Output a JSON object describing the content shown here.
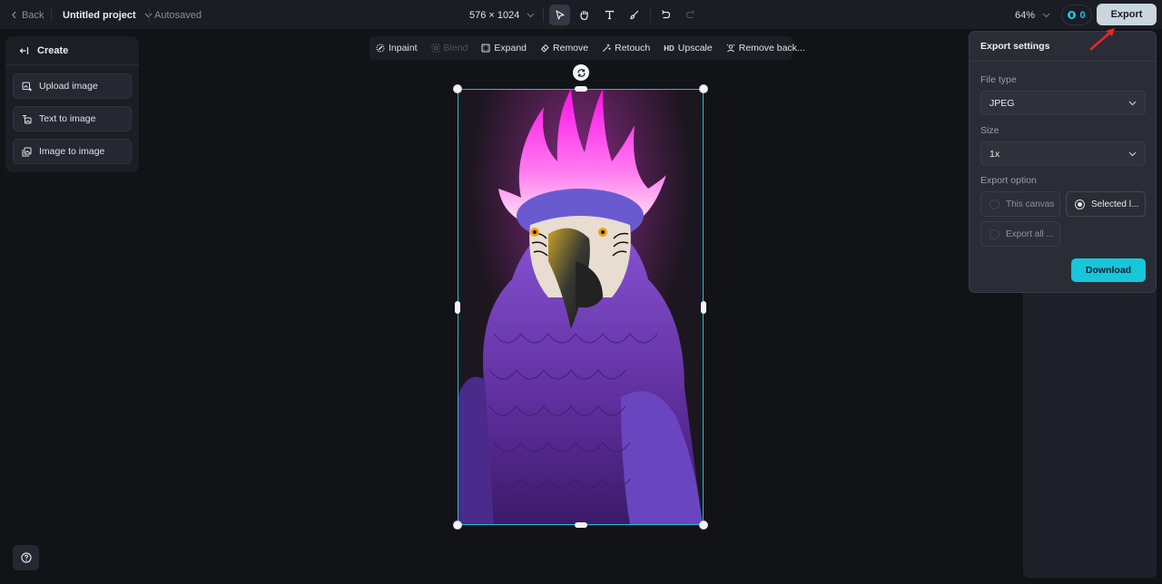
{
  "topbar": {
    "back_label": "Back",
    "project_name": "Untitled project",
    "save_status": "Autosaved",
    "canvas_dimensions": "576 × 1024",
    "tools": [
      "select",
      "hand",
      "text",
      "brush",
      "undo",
      "redo"
    ],
    "active_tool": "select",
    "zoom_level": "64%",
    "credits": "0",
    "export_label": "Export"
  },
  "create_panel": {
    "title": "Create",
    "items": [
      {
        "label": "Upload image",
        "icon": "upload-image-icon"
      },
      {
        "label": "Text to image",
        "icon": "text-to-image-icon"
      },
      {
        "label": "Image to image",
        "icon": "image-to-image-icon"
      }
    ]
  },
  "edit_toolbar": {
    "items": [
      {
        "label": "Inpaint",
        "icon": "inpaint-icon",
        "enabled": true
      },
      {
        "label": "Blend",
        "icon": "blend-icon",
        "enabled": false
      },
      {
        "label": "Expand",
        "icon": "expand-icon",
        "enabled": true
      },
      {
        "label": "Remove",
        "icon": "eraser-icon",
        "enabled": true
      },
      {
        "label": "Retouch",
        "icon": "magic-wand-icon",
        "enabled": true
      },
      {
        "label": "Upscale",
        "icon": "hd-icon",
        "icon_text": "HD",
        "enabled": true
      },
      {
        "label": "Remove back...",
        "icon": "remove-background-icon",
        "enabled": true
      }
    ]
  },
  "canvas": {
    "image_description": "Purple parrot with glowing magenta flame crest on dark background",
    "selection_color": "#1ec0d0"
  },
  "export_settings": {
    "title": "Export settings",
    "file_type_label": "File type",
    "file_type_value": "JPEG",
    "size_label": "Size",
    "size_value": "1x",
    "export_option_label": "Export option",
    "options": [
      {
        "label": "This canvas",
        "selected": false
      },
      {
        "label": "Selected l...",
        "selected": true
      },
      {
        "label": "Export all ...",
        "selected": false
      }
    ],
    "download_label": "Download"
  },
  "colors": {
    "accent": "#17c6db",
    "background": "#121317",
    "annotation_arrow": "#e8262b"
  }
}
